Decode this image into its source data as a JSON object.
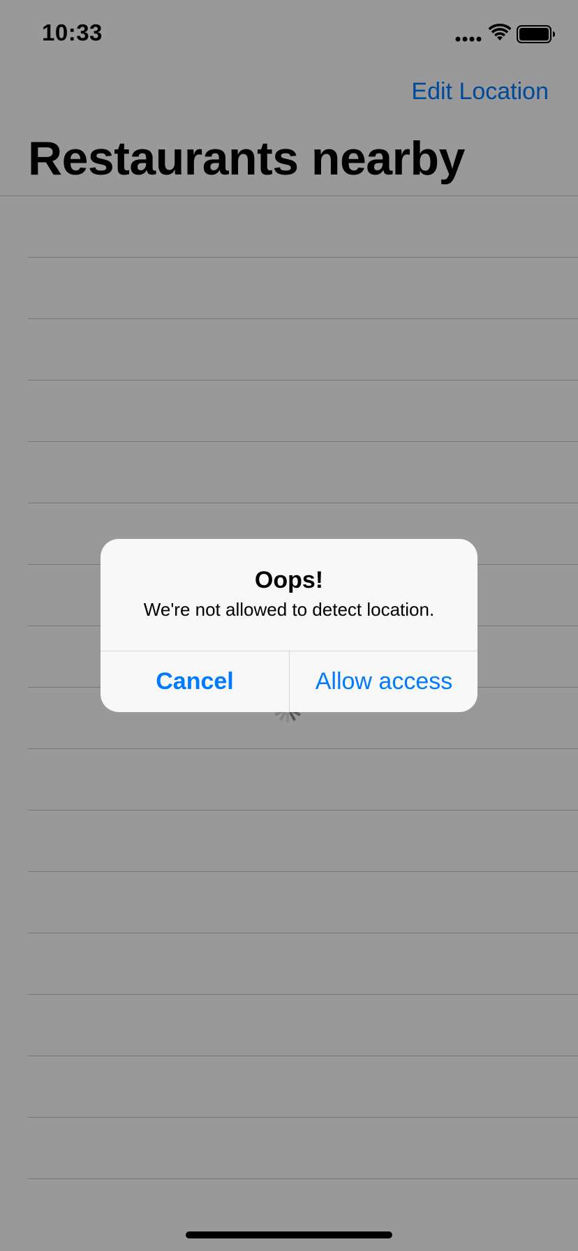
{
  "status_bar": {
    "time": "10:33",
    "icons": [
      "cellular-signal-icon",
      "wifi-icon",
      "battery-icon"
    ]
  },
  "nav": {
    "right_button_label": "Edit Location",
    "title": "Restaurants nearby"
  },
  "table": {
    "empty_row_count": 16
  },
  "loading": {
    "icon": "activity-spinner-icon"
  },
  "alert": {
    "title": "Oops!",
    "message": "We're not allowed to detect location.",
    "cancel_label": "Cancel",
    "allow_label": "Allow access"
  },
  "colors": {
    "accent": "#007aff",
    "dim_overlay": "rgba(0,0,0,0.40)",
    "alert_background": "#f8f8f8",
    "separator": "#c8c8c8"
  }
}
